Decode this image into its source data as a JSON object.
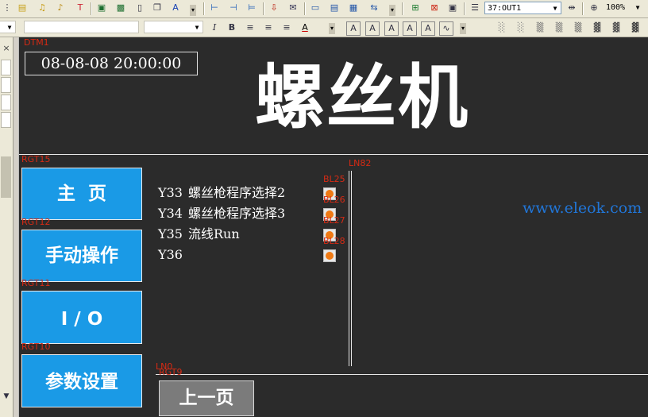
{
  "toolbar": {
    "station_combo": "37:OUT1",
    "zoom_combo": "100%"
  },
  "screen": {
    "datetime_tag": "DTM1",
    "datetime_value": "08-08-08 20:00:00",
    "title": "螺丝机",
    "nav": [
      {
        "tag": "RGT15",
        "label": "主  页"
      },
      {
        "tag": "RGT12",
        "label": "手动操作"
      },
      {
        "tag": "RGT11",
        "label": "I / O"
      },
      {
        "tag": "RGT10",
        "label": "参数设置"
      }
    ],
    "io_rows": [
      {
        "code": "Y33",
        "text": "螺丝枪程序选择2"
      },
      {
        "code": "Y34",
        "text": "螺丝枪程序选择3"
      },
      {
        "code": "Y35",
        "text": "流线Run"
      },
      {
        "code": "Y36",
        "text": ""
      }
    ],
    "lamp_tags": [
      "BL25",
      "BL26",
      "BL27",
      "BL28"
    ],
    "line_tags": {
      "vertical": "LN82",
      "bottom": "LN0"
    },
    "prev_tag": "RGT9",
    "prev_label": "上一页",
    "watermark": "www.eleok.com"
  },
  "colors": {
    "nav_button": "#1a9ae6",
    "canvas": "#2b2b2b",
    "lamp": "#f07a14",
    "tag": "#d62a14",
    "watermark": "#2176d8"
  }
}
